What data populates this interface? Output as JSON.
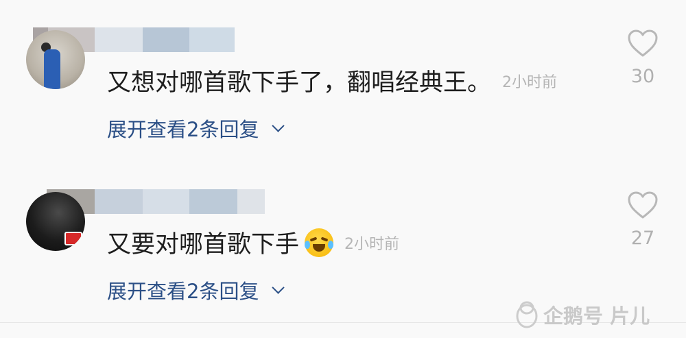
{
  "comments": [
    {
      "name_blur_colors": [
        "#a9a3a3",
        "#c9c4c4",
        "#dde3ea",
        "#b7c6d6",
        "#cfdbe6",
        "#e8ecf1"
      ],
      "text": "又想对哪首歌下手了，翻唱经典王。",
      "time": "2小时前",
      "likes": "30",
      "expand": "展开查看2条回复"
    },
    {
      "name_blur_colors": [
        "#a9a6a2",
        "#c6d0dc",
        "#d6dee7",
        "#bccad8",
        "#dfe3e8"
      ],
      "text": "又要对哪首歌下手",
      "emoji": "laughing-crying-emoji",
      "time": "2小时前",
      "likes": "27",
      "expand": "展开查看2条回复"
    }
  ],
  "watermark": {
    "text": "企鹅号 片儿",
    "icon": "penguin-icon"
  },
  "colors": {
    "link": "#2b4f86",
    "meta": "#b5b5b5",
    "background": "#f9f9f9"
  }
}
